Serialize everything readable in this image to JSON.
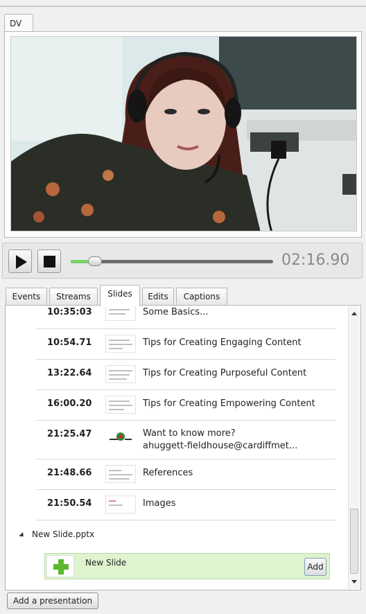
{
  "video": {
    "tab_label": "DV"
  },
  "transport": {
    "time": "02:16.90",
    "progress": 0.12
  },
  "tabs": [
    {
      "label": "Events"
    },
    {
      "label": "Streams"
    },
    {
      "label": "Slides",
      "active": true
    },
    {
      "label": "Edits"
    },
    {
      "label": "Captions"
    }
  ],
  "slides": {
    "items": [
      {
        "time": "10:35:03",
        "title": "Some Basics..."
      },
      {
        "time": "10:54.71",
        "title": "Tips for Creating Engaging Content"
      },
      {
        "time": "13:22.64",
        "title": "Tips for Creating Purposeful Content"
      },
      {
        "time": "16:00.20",
        "title": "Tips for Creating Empowering Content"
      },
      {
        "time": "21:25.47",
        "title": "Want to know more?",
        "title2": "ahuggett-fieldhouse@cardiffmet..."
      },
      {
        "time": "21:48.66",
        "title": "References"
      },
      {
        "time": "21:50.54",
        "title": "Images"
      }
    ],
    "group_name": "New Slide.pptx",
    "new_slide_title": "New Slide",
    "add_label": "Add"
  },
  "footer": {
    "add_presentation_label": "Add a presentation"
  }
}
